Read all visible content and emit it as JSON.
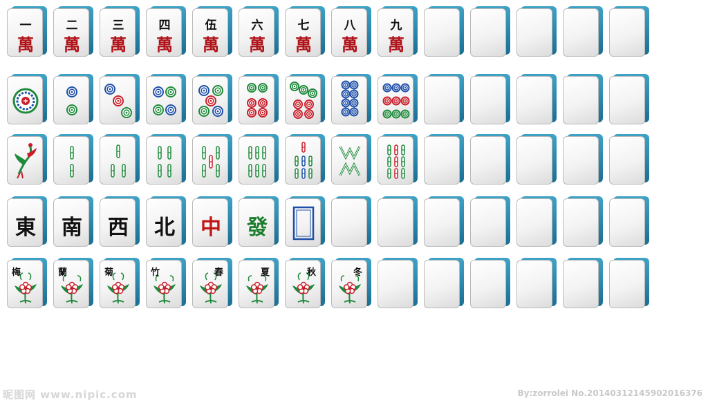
{
  "rows": {
    "characters": {
      "numerals": [
        "一",
        "二",
        "三",
        "四",
        "伍",
        "六",
        "七",
        "八",
        "九"
      ],
      "suit_glyph": "萬",
      "blank_count": 5
    },
    "circles": {
      "values": [
        1,
        2,
        3,
        4,
        5,
        6,
        7,
        8,
        9
      ],
      "blank_count": 5
    },
    "bamboo": {
      "values": [
        1,
        2,
        3,
        4,
        5,
        6,
        7,
        8,
        9
      ],
      "blank_count": 5
    },
    "honors": {
      "winds": [
        "東",
        "南",
        "西",
        "北"
      ],
      "red_dragon": "中",
      "green_dragon": "發",
      "white_dragon": "frame",
      "blank_count": 7
    },
    "flowers": {
      "labels": [
        "梅",
        "蘭",
        "菊",
        "竹",
        "春",
        "夏",
        "秋",
        "冬"
      ],
      "blank_count": 6
    }
  },
  "colors": {
    "tile_back": "#2a87ad",
    "wan_red": "#b0141a",
    "dot_blue": "#1f4fa8",
    "dot_green": "#1e8a3a",
    "dot_red": "#c81e2a",
    "bamboo_green": "#1e8a3a"
  },
  "watermark": {
    "left": "昵图网 www.nipic.com",
    "right": "By:zorrolei  No.20140312145902016376"
  }
}
